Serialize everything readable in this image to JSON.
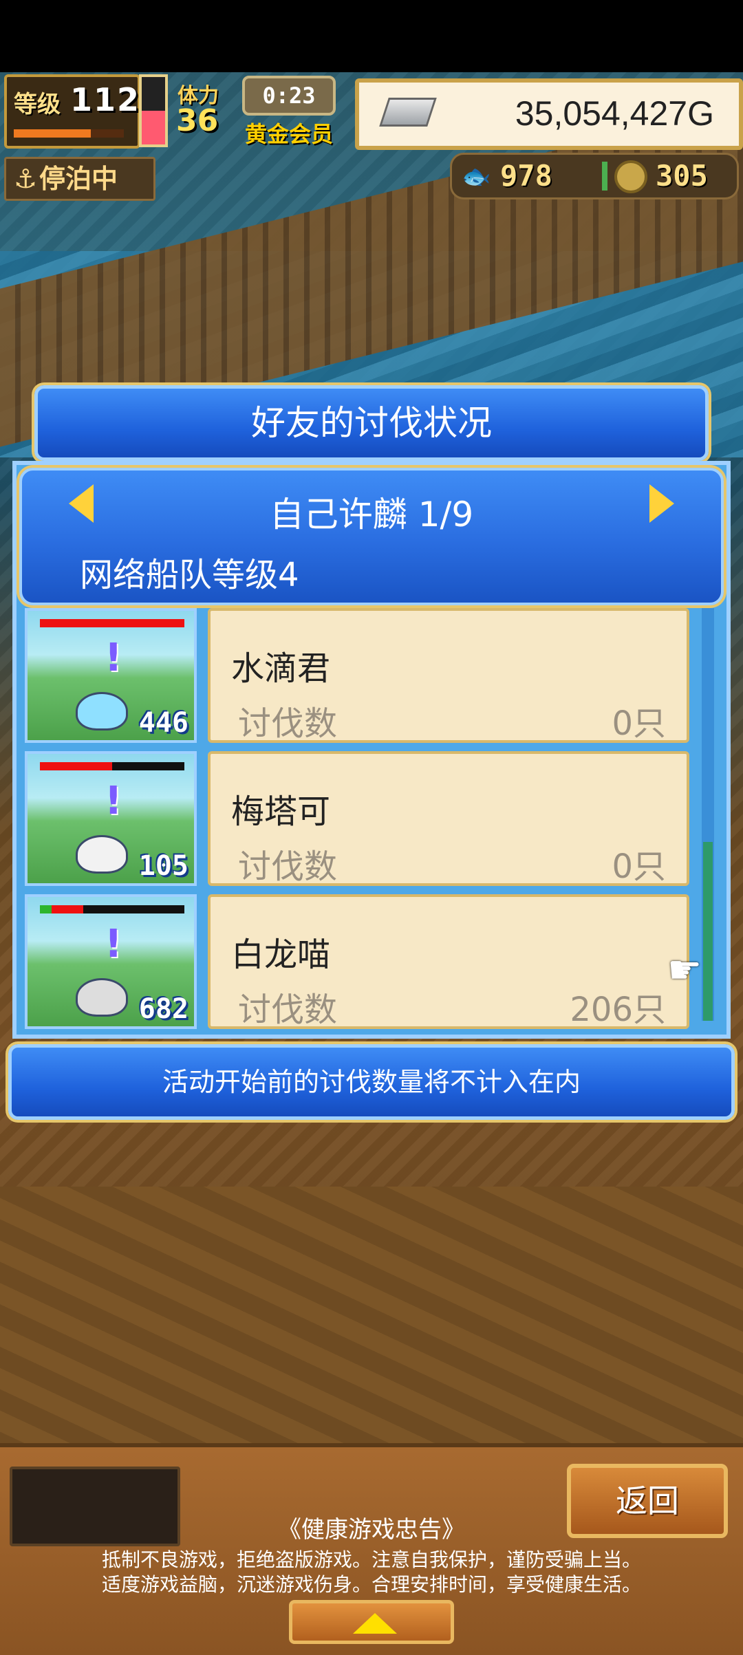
{
  "hud": {
    "level_label": "等级",
    "level_value": "112",
    "level_progress": 0.7,
    "stamina_fill": 0.5,
    "stamina_label": "体力",
    "stamina_value": "36",
    "timer": "0:23",
    "member_label": "黄金会员",
    "gold": "35,054,427G",
    "status": "停泊中",
    "fish_count": "978",
    "coin_count": "305"
  },
  "dialog": {
    "title": "好友的讨伐状况",
    "friend_name": "自己许麟 1/9",
    "fleet_level": "网络船队等级4",
    "rows": [
      {
        "name": "水滴君",
        "kill_label": "讨伐数",
        "kill_value": "0只",
        "count": "446",
        "hp": 1.0,
        "hp_green": 0,
        "color": "#8fe0ff"
      },
      {
        "name": "梅塔可",
        "kill_label": "讨伐数",
        "kill_value": "0只",
        "count": "105",
        "hp": 0.5,
        "hp_green": 0,
        "color": "#f2f2f2"
      },
      {
        "name": "白龙喵",
        "kill_label": "讨伐数",
        "kill_value": "206只",
        "count": "682",
        "hp": 0.3,
        "hp_green": 0.08,
        "color": "#dddddd"
      }
    ],
    "note": "活动开始前的讨伐数量将不计入在内"
  },
  "bottom": {
    "back_label": "返回",
    "notice_title": "《健康游戏忠告》",
    "notice_line1": "抵制不良游戏，拒绝盗版游戏。注意自我保护，谨防受骗上当。",
    "notice_line2": "适度游戏益脑，沉迷游戏伤身。合理安排时间，享受健康生活。"
  },
  "icons": {
    "anchor": "anchor-icon",
    "fish": "fish-icon",
    "coin": "coin-icon",
    "silver_bar": "silver-bar-icon",
    "pointer_hand": "pointer-hand-icon"
  }
}
